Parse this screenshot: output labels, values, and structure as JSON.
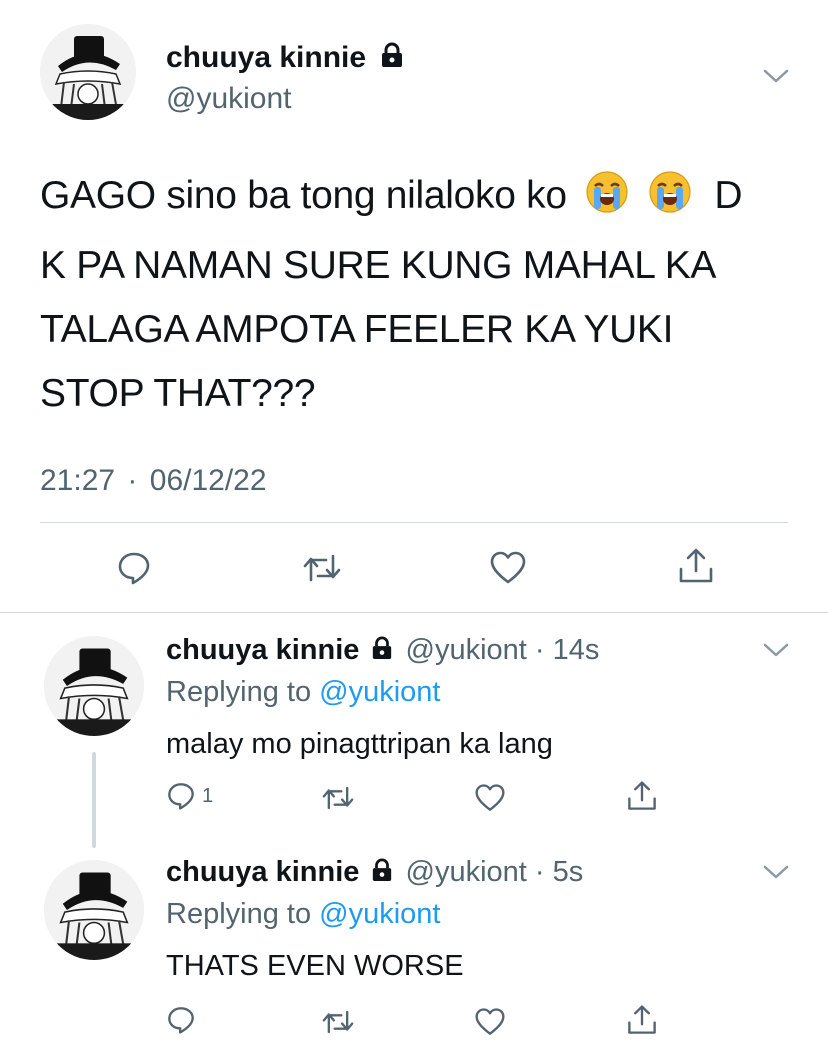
{
  "main_tweet": {
    "author_name": "chuuya kinnie",
    "handle": "@yukiont",
    "text_part1": "GAGO sino ba tong nilaloko ko",
    "text_part2": "D",
    "text_line2": "K PA NAMAN SURE KUNG MAHAL KA",
    "text_line3": "TALAGA AMPOTA FEELER KA YUKI",
    "text_line4": "STOP THAT???",
    "time": "21:27",
    "separator": "·",
    "date": "06/12/22",
    "emoji": "loudly-crying-face"
  },
  "replies": [
    {
      "author_name": "chuuya kinnie",
      "handle": "@yukiont",
      "separator": "·",
      "age": "14s",
      "replying_prefix": "Replying to",
      "replying_to": "@yukiont",
      "text": "malay mo pinagttripan ka lang",
      "reply_count": "1"
    },
    {
      "author_name": "chuuya kinnie",
      "handle": "@yukiont",
      "separator": "·",
      "age": "5s",
      "replying_prefix": "Replying to",
      "replying_to": "@yukiont",
      "text": "THATS EVEN WORSE",
      "reply_count": ""
    }
  ],
  "colors": {
    "text": "#0f1419",
    "secondary": "#536471",
    "link": "#1d9bf0",
    "divider": "#cfd9de",
    "thread_line": "#cfd9de"
  }
}
